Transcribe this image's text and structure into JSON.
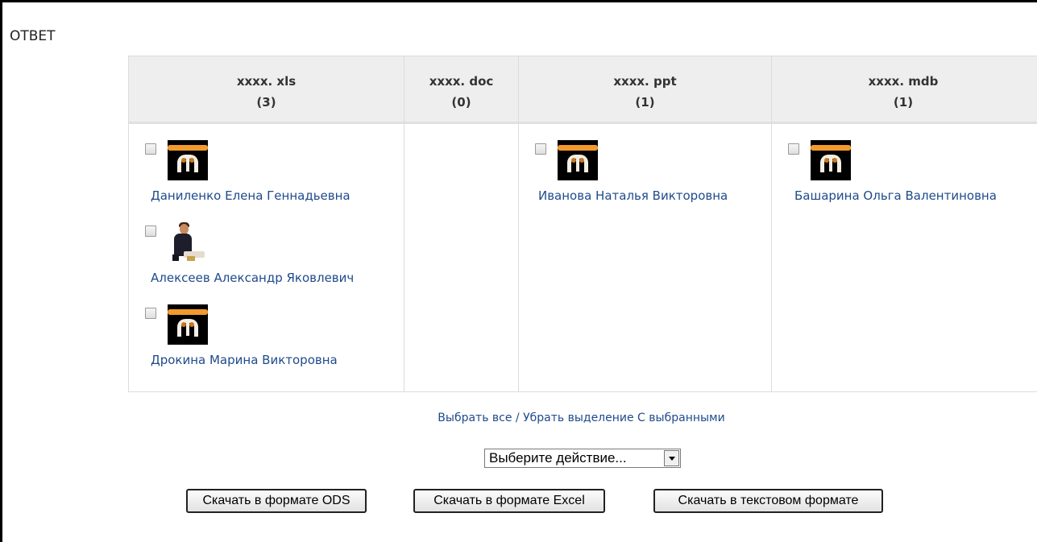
{
  "section_title": "ОТВЕТ",
  "columns": [
    {
      "name": "xxxx. xls",
      "count": "(3)",
      "entries": [
        "Даниленко Елена Геннадьевна",
        "Алексеев Александр Яковлевич",
        "Дрокина Марина Викторовна"
      ]
    },
    {
      "name": "xxxx. doc",
      "count": "(0)",
      "entries": []
    },
    {
      "name": "xxxx. ppt",
      "count": "(1)",
      "entries": [
        "Иванова Наталья Викторовна"
      ]
    },
    {
      "name": "xxxx. mdb",
      "count": "(1)",
      "entries": [
        "Башарина Ольга Валентиновна"
      ]
    }
  ],
  "selection": {
    "select_all": "Выбрать все",
    "separator": " / ",
    "deselect": "Убрать выделение",
    "with_selected": " С выбранными"
  },
  "action_select": {
    "value": "Выберите действие..."
  },
  "buttons": {
    "ods": "Скачать в формате ODS",
    "excel": "Скачать в формате Excel",
    "text": "Скачать в текстовом формате"
  },
  "colors": {
    "link": "#1f4a8c",
    "header_bg": "#eeeeee",
    "logo_orange": "#f39a2c"
  }
}
